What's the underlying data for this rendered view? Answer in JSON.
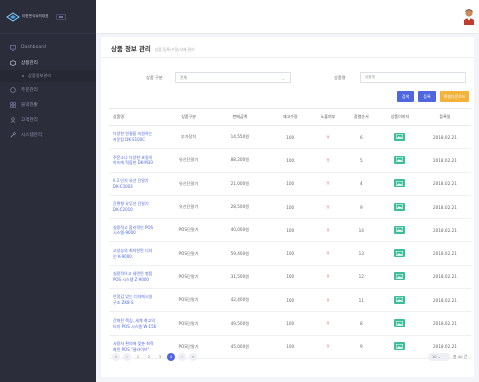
{
  "app": {
    "brand": "이한번식씨의대표"
  },
  "colors": {
    "sidebar": "#2b2d3a",
    "primary": "#4f66e0",
    "excel": "#f3b23a",
    "image_button": "#3ebd9a",
    "exposure": "#e8544c"
  },
  "sidebar": {
    "items": [
      {
        "label": "Dashboard",
        "icon": "monitor-icon"
      },
      {
        "label": "상품관리",
        "icon": "box-icon",
        "active": true
      },
      {
        "label": "상품정보관리",
        "sub": true
      },
      {
        "label": "주문관리",
        "icon": "cart-icon"
      },
      {
        "label": "블럭현황",
        "icon": "grid-icon"
      },
      {
        "label": "고객관리",
        "icon": "user-icon"
      },
      {
        "label": "시스템관리",
        "icon": "wrench-icon"
      }
    ]
  },
  "header": {
    "title": "상품 정보 관리",
    "subtitle": "상품 등록/수정/삭제 관리"
  },
  "filters": {
    "type_label": "상품 구분",
    "type_value": "전체",
    "name_label": "상품명",
    "name_placeholder": "상품명"
  },
  "buttons": {
    "search": "검색",
    "register": "등록",
    "excel": "엑셀다운로드"
  },
  "table": {
    "headers": [
      "상품명",
      "상품구분",
      "판매금액",
      "재고수량",
      "노출여부",
      "정렬순서",
      "상품이미지",
      "등록일"
    ],
    "rows": [
      {
        "name1": "다양한 연결을 지원하는",
        "name2": "카운팅 DK-S100C",
        "type": "부가장치",
        "price": "14,550원",
        "stock": "100",
        "show": "Y",
        "order": "6",
        "date": "2018.02.21"
      },
      {
        "name1": "주문소나 다양한 초밀이",
        "name2": "아즈에 적합한 DK-M30",
        "type": "유선단말기",
        "price": "88,200원",
        "stock": "100",
        "show": "Y",
        "order": "5",
        "date": "2018.02.21"
      },
      {
        "name1": "ll.3 인치 유선 단말기",
        "name2": "DK-C3003",
        "type": "유선단말기",
        "price": "21,000원",
        "stock": "100",
        "show": "Y",
        "order": "4",
        "date": "2018.02.21"
      },
      {
        "name1": "간편형 유무선 단말기",
        "name2": "DK-C2010",
        "type": "유선단말기",
        "price": "28,500원",
        "stock": "100",
        "show": "Y",
        "order": "9",
        "date": "2018.02.21"
      },
      {
        "name1": "실용적고 합리적인 POS",
        "name2": "시스템-9000",
        "type": "POS단말기",
        "price": "40,000원",
        "stock": "100",
        "show": "Y",
        "order": "14",
        "date": "2018.02.21"
      },
      {
        "name1": "고성능의 최저한된 디자",
        "name2": "인 K-9000",
        "type": "POS단말기",
        "price": "59,400원",
        "stock": "100",
        "show": "Y",
        "order": "13",
        "date": "2018.02.21"
      },
      {
        "name1": "실용적으고 세련된 형품",
        "name2": "POS 시스템 Z-9000",
        "type": "POS단말기",
        "price": "31,500원",
        "stock": "100",
        "show": "Y",
        "order": "12",
        "date": "2018.02.21"
      },
      {
        "name1": "안정감 있는 디자에시일",
        "name2": "구조 ZK8-S",
        "type": "POS단말기",
        "price": "42,400원",
        "stock": "100",
        "show": "Y",
        "order": "11",
        "date": "2018.02.21"
      },
      {
        "name1": "간화된 핵심, 세계 최고의",
        "name2": "터치 POS 시스템 W-156",
        "type": "POS단말기",
        "price": "49,500원",
        "stock": "100",
        "show": "Y",
        "order": "8",
        "date": "2018.02.21"
      },
      {
        "name1": "사용자 편의에 맞춘 최적",
        "name2": "화된 POS \"클라이브\"",
        "type": "POS단말기",
        "price": "45,000원",
        "stock": "100",
        "show": "Y",
        "order": "9",
        "date": "2018.02.21"
      }
    ]
  },
  "pagination": {
    "pages": [
      "«",
      "‹",
      "1",
      "2",
      "3",
      "4",
      "›",
      "»"
    ],
    "current": "4",
    "page_size": "10",
    "total": "총 40 건"
  }
}
